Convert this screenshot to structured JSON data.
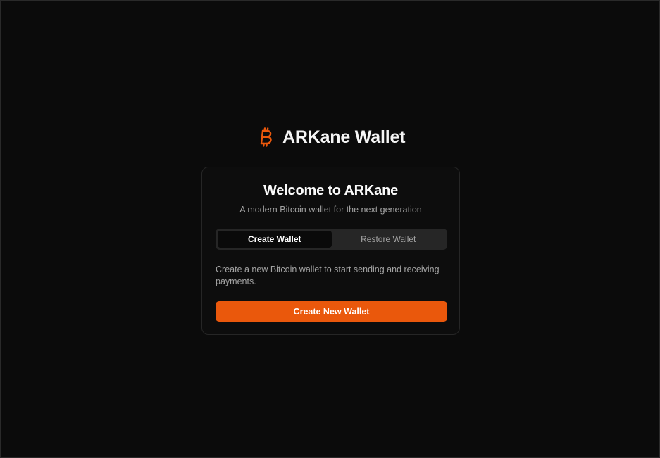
{
  "app": {
    "title": "ARKane Wallet",
    "logo_icon": "bitcoin-icon",
    "accent_color": "#ea580c"
  },
  "card": {
    "heading": "Welcome to ARKane",
    "subheading": "A modern Bitcoin wallet for the next generation",
    "tabs": [
      {
        "label": "Create Wallet",
        "active": true
      },
      {
        "label": "Restore Wallet",
        "active": false
      }
    ],
    "description": "Create a new Bitcoin wallet to start sending and receiving payments.",
    "primary_button_label": "Create New Wallet"
  }
}
